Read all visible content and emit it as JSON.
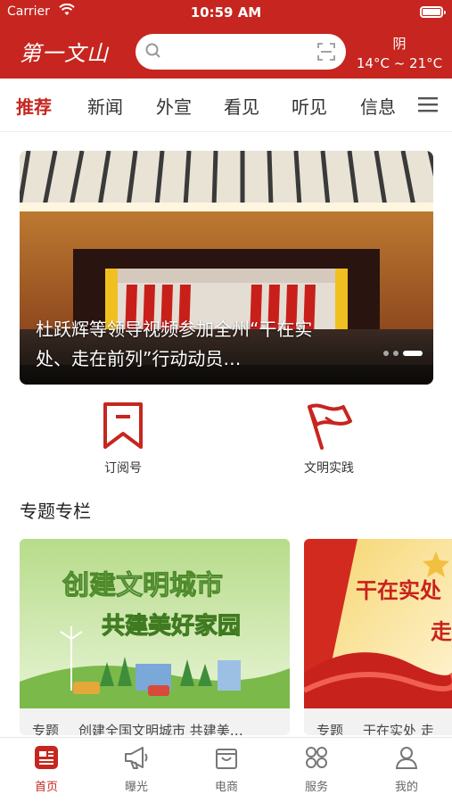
{
  "status_bar": {
    "carrier": "Carrier",
    "time": "10:59 AM"
  },
  "header": {
    "logo_text": "第一文山",
    "search": {
      "placeholder": ""
    },
    "weather": {
      "condition": "阴",
      "range": "14°C ~ 21°C"
    }
  },
  "tabs": [
    {
      "label": "推荐",
      "active": true
    },
    {
      "label": "新闻"
    },
    {
      "label": "外宣"
    },
    {
      "label": "看见"
    },
    {
      "label": "听见"
    },
    {
      "label": "信息"
    }
  ],
  "banner": {
    "caption": "杜跃辉等领导视频参加全州“干在实处、走在前列”行动动员…",
    "slide_count": 3,
    "active_slide": 3
  },
  "shortcuts": [
    {
      "label": "订阅号",
      "icon": "bookmark-icon"
    },
    {
      "label": "文明实践",
      "icon": "flag-icon"
    }
  ],
  "section": {
    "title": "专题专栏",
    "cards": [
      {
        "tag": "专题",
        "title": "创建全国文明城市 共建美…",
        "image_text_1": "创建文明城市",
        "image_text_2": "共建美好家园"
      },
      {
        "tag": "专题",
        "title": "干在实处 走",
        "image_text_1": "干在实处",
        "image_text_2": "走"
      }
    ]
  },
  "tabbar": [
    {
      "label": "首页",
      "icon": "home-news-icon",
      "active": true
    },
    {
      "label": "曝光",
      "icon": "megaphone-icon"
    },
    {
      "label": "电商",
      "icon": "shopping-bag-icon"
    },
    {
      "label": "服务",
      "icon": "grid-services-icon"
    },
    {
      "label": "我的",
      "icon": "user-icon"
    }
  ],
  "colors": {
    "brand_red": "#c6261f"
  }
}
